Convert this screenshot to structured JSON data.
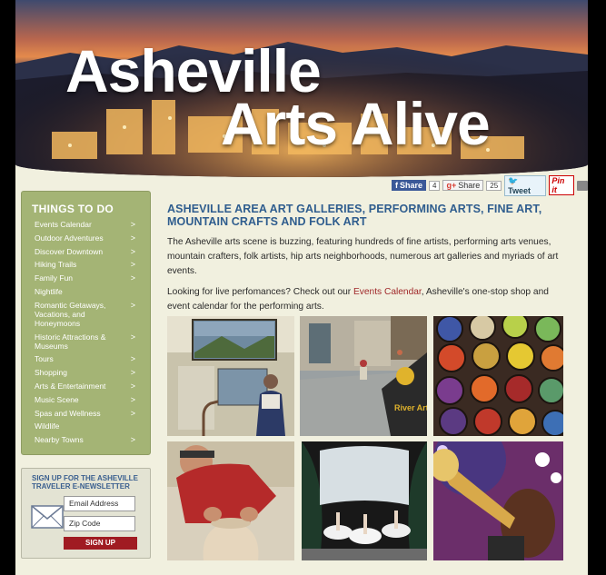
{
  "hero": {
    "title_line1": "Asheville",
    "title_line2": "Arts Alive"
  },
  "share_bar": {
    "facebook_label": "Share",
    "facebook_count": "4",
    "google_label": "Share",
    "google_count": "25",
    "tweet_label": "Tweet",
    "pin_label": "Pin it"
  },
  "sidebar": {
    "title": "THINGS TO DO",
    "items": [
      {
        "label": "Events Calendar",
        "arrow": ">"
      },
      {
        "label": "Outdoor Adventures",
        "arrow": ">"
      },
      {
        "label": "Discover Downtown",
        "arrow": ">"
      },
      {
        "label": "Hiking Trails",
        "arrow": ">"
      },
      {
        "label": "Family Fun",
        "arrow": ">"
      },
      {
        "label": "Nightlife",
        "arrow": ""
      },
      {
        "label": "Romantic Getaways,\nVacations, and\nHoneymoons",
        "arrow": ">"
      },
      {
        "label": "Historic Attractions &\nMuseums",
        "arrow": ">"
      },
      {
        "label": "Tours",
        "arrow": ">"
      },
      {
        "label": "Shopping",
        "arrow": ">"
      },
      {
        "label": "Arts & Entertainment",
        "arrow": ">"
      },
      {
        "label": "Music Scene",
        "arrow": ">"
      },
      {
        "label": "Spas and Wellness",
        "arrow": ">"
      },
      {
        "label": "Wildlife",
        "arrow": ""
      },
      {
        "label": "Nearby Towns",
        "arrow": ">"
      }
    ]
  },
  "newsletter": {
    "title": "SIGN UP FOR THE ASHEVILLE\nTRAVELER E-NEWSLETTER",
    "email_placeholder": "Email Address",
    "zip_placeholder": "Zip Code",
    "button_label": "SIGN UP"
  },
  "main": {
    "heading": "ASHEVILLE AREA ART GALLERIES, PERFORMING ARTS, FINE ART, MOUNTAIN CRAFTS AND FOLK ART",
    "paragraph1": "The Asheville arts scene is buzzing, featuring hundreds of fine artists, performing arts venues, mountain crafters, folk artists, hip arts neighborhoods, numerous art galleries and myriads of art events.",
    "paragraph2_before": "Looking for live perfomances? Check out our ",
    "paragraph2_link": "Events Calendar",
    "paragraph2_after": ", Asheville's one-stop shop and event calendar for the performing arts."
  },
  "photo_sign_text": "River Arts Dist."
}
